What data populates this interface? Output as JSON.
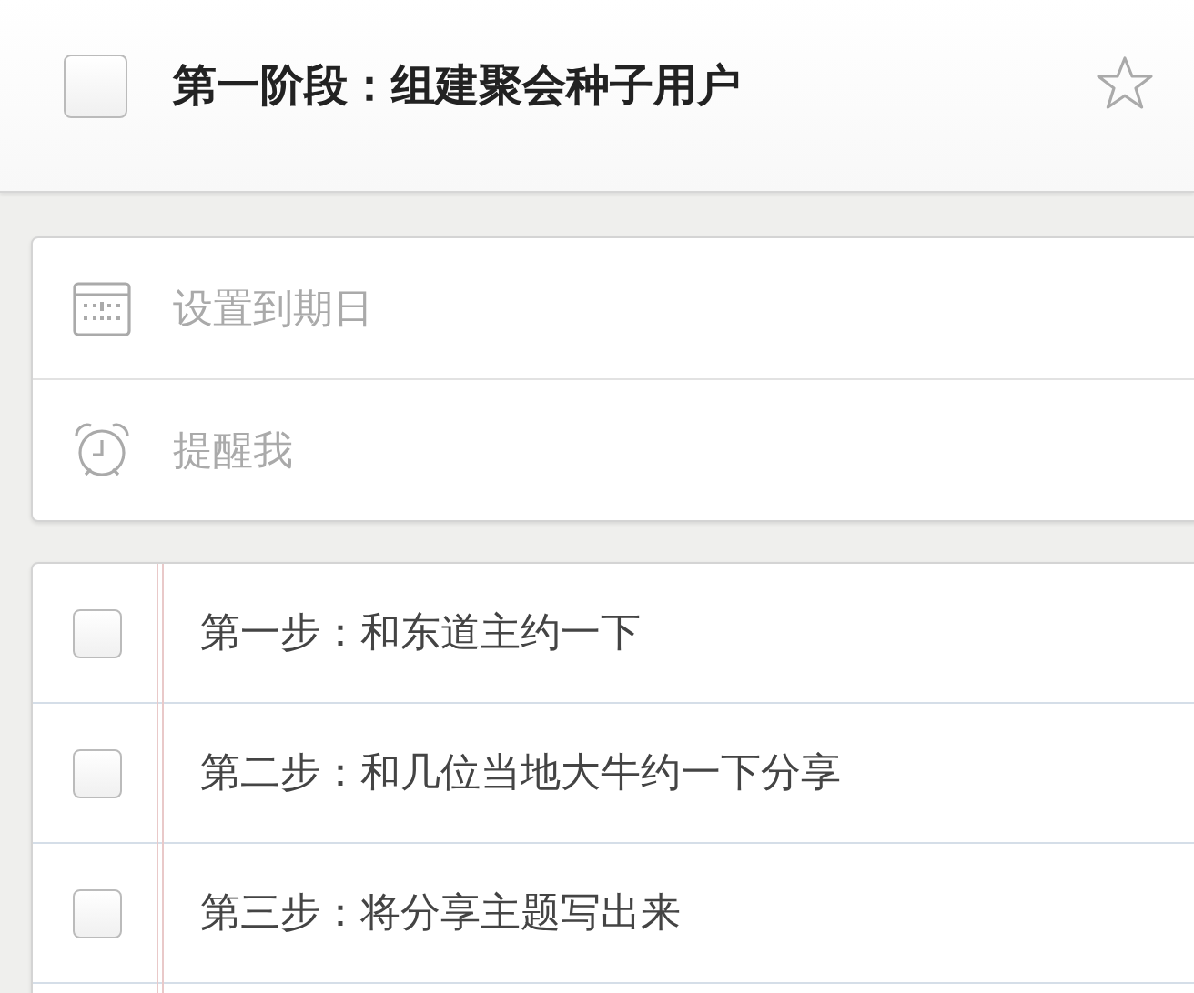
{
  "task": {
    "title": "第一阶段：组建聚会种子用户",
    "completed": false,
    "starred": false
  },
  "options": [
    {
      "kind": "due-date",
      "placeholder": "设置到期日"
    },
    {
      "kind": "reminder",
      "placeholder": "提醒我"
    }
  ],
  "subtasks": [
    {
      "label": "第一步：和东道主约一下",
      "completed": false
    },
    {
      "label": "第二步：和几位当地大牛约一下分享",
      "completed": false
    },
    {
      "label": "第三步：将分享主题写出来",
      "completed": false
    }
  ]
}
